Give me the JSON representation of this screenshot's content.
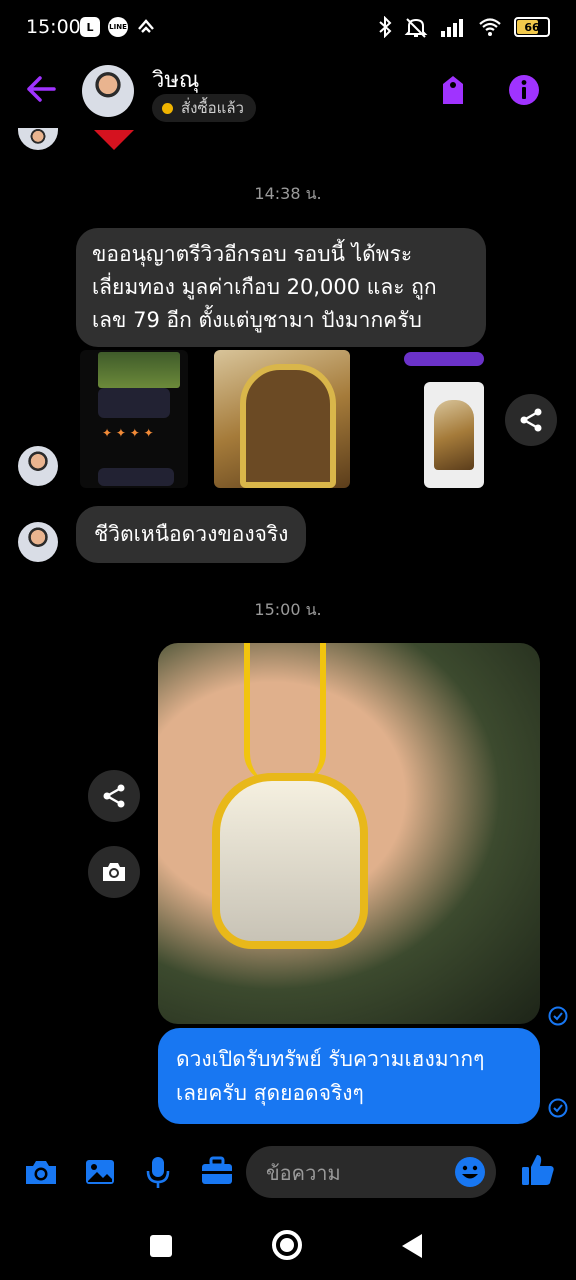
{
  "status_bar": {
    "time": "15:00",
    "line_badge": "L",
    "line_label": "LINE",
    "battery": "66",
    "battery_level": 0.66
  },
  "header": {
    "contact_name": "วิษณุ",
    "status_chip": "สั่งซื้อแล้ว",
    "colors": {
      "accent": "#a033ff",
      "status_dot": "#f0b400"
    }
  },
  "messages": {
    "timestamp_1": "14:38 น.",
    "review_message": [
      "ขออนุญาตรีวิวอีกรอบ รอบนี้ ได้พระ",
      "เลี่ยมทอง มูลค่าเกือบ 20,000 และ ถูก",
      "เลข 79 อีก  ตั้งแต่บูชามา ปังมากครับ"
    ],
    "reply_message": "ชีวิตเหนือดวงของจริง",
    "timestamp_2": "15:00 น.",
    "outgoing_message": [
      "ดวงเปิดรับทรัพย์ รับความเฮงมากๆ",
      "เลยครับ สุดยอดจริงๆ"
    ]
  },
  "composer": {
    "placeholder": "ข้อความ"
  },
  "colors": {
    "background": "#000000",
    "incoming_bubble": "#303030",
    "outgoing_bubble": "#1877f2",
    "icon_blue": "#1877f2"
  }
}
